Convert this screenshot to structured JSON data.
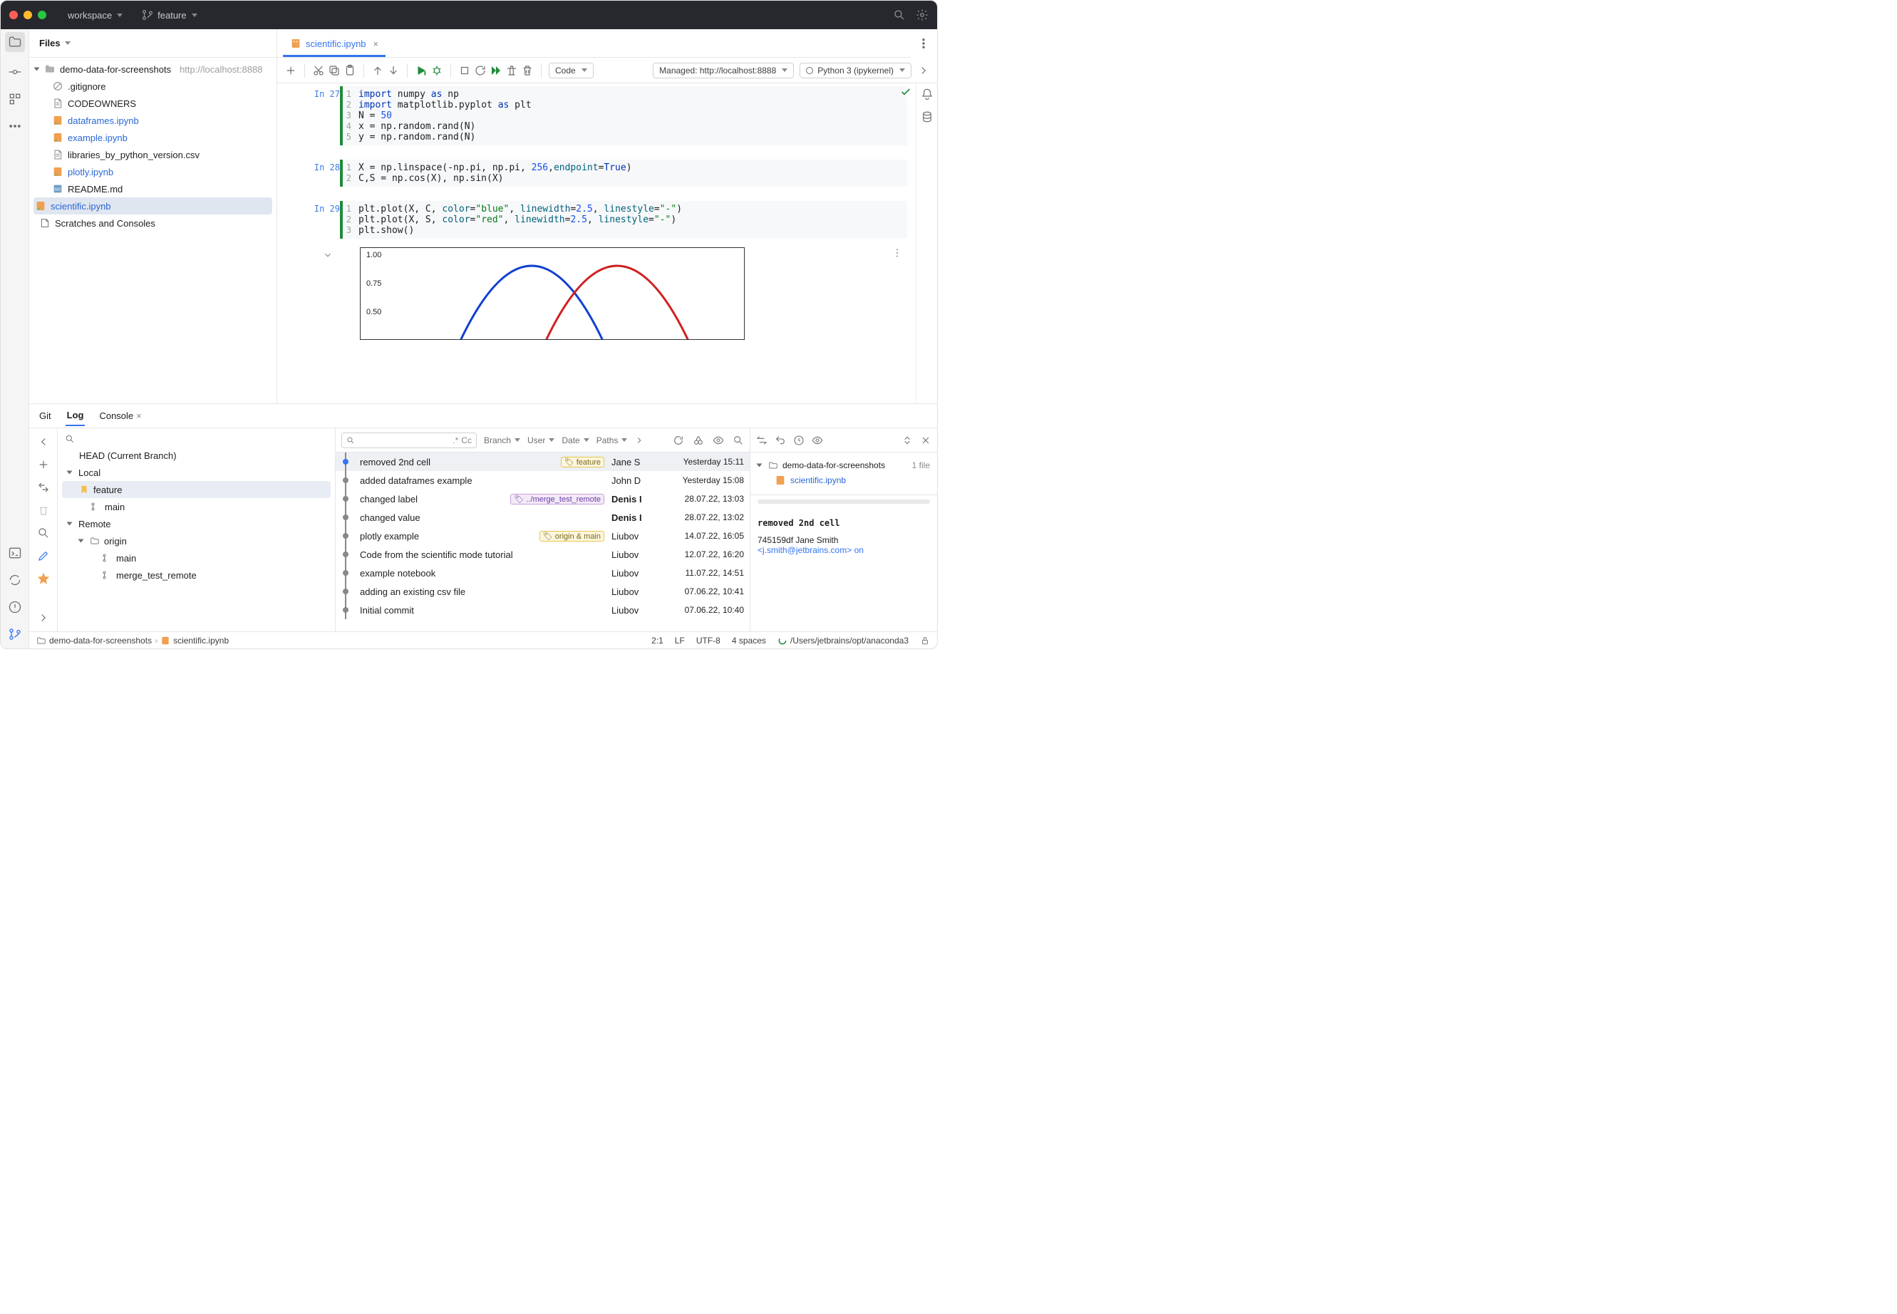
{
  "titlebar": {
    "workspace": "workspace",
    "branch": "feature"
  },
  "project": {
    "header": "Files",
    "root": "demo-data-for-screenshots",
    "root_addr": "http://localhost:8888",
    "items": [
      {
        "name": ".gitignore",
        "icon": "ignore"
      },
      {
        "name": "CODEOWNERS",
        "icon": "txt"
      },
      {
        "name": "dataframes.ipynb",
        "icon": "nb",
        "link": true
      },
      {
        "name": "example.ipynb",
        "icon": "nb",
        "link": true
      },
      {
        "name": "libraries_by_python_version.csv",
        "icon": "txt"
      },
      {
        "name": "plotly.ipynb",
        "icon": "nb",
        "link": true
      },
      {
        "name": "README.md",
        "icon": "md"
      },
      {
        "name": "scientific.ipynb",
        "icon": "nb",
        "link": true,
        "selected": true
      }
    ],
    "scratches": "Scratches and Consoles"
  },
  "tabs": {
    "active": "scientific.ipynb"
  },
  "nb_toolbar": {
    "cell_type": "Code",
    "managed": "Managed: http://localhost:8888",
    "kernel": "Python 3 (ipykernel)"
  },
  "cells": [
    {
      "prompt": "In 27",
      "lines": [
        "import numpy as np",
        "import matplotlib.pyplot as plt",
        "N = 50",
        "x = np.random.rand(N)",
        "y = np.random.rand(N)"
      ]
    },
    {
      "prompt": "In 28",
      "lines": [
        "X = np.linspace(-np.pi, np.pi, 256,endpoint=True)",
        "C,S = np.cos(X), np.sin(X)"
      ]
    },
    {
      "prompt": "In 29",
      "lines": [
        "plt.plot(X, C, color=\"blue\", linewidth=2.5, linestyle=\"-\")",
        "plt.plot(X, S, color=\"red\", linewidth=2.5, linestyle=\"-\")",
        "plt.show()"
      ]
    }
  ],
  "plot_yticks": [
    "1.00",
    "0.75",
    "0.50"
  ],
  "bottom_tabs": [
    "Git",
    "Log",
    "Console"
  ],
  "bottom_tabs_active": "Log",
  "git": {
    "head_label": "HEAD (Current Branch)",
    "local": "Local",
    "remote": "Remote",
    "origin": "origin",
    "branches_local": [
      "feature",
      "main"
    ],
    "branches_remote": [
      "main",
      "merge_test_remote"
    ],
    "filters": [
      "Branch",
      "User",
      "Date",
      "Paths"
    ],
    "search_regex": ".*",
    "search_cc": "Cc",
    "commits": [
      {
        "msg": "removed 2nd cell",
        "tag": "feature",
        "tag_color": "yellow",
        "author": "Jane S",
        "date": "Yesterday 15:11",
        "head": true,
        "sel": true
      },
      {
        "msg": "added dataframes example",
        "author": "John D",
        "date": "Yesterday 15:08"
      },
      {
        "msg": "changed label",
        "tag": "../merge_test_remote",
        "tag_color": "purple",
        "author": "Denis I",
        "date": "28.07.22, 13:03",
        "bold": true
      },
      {
        "msg": "changed value",
        "author": "Denis I",
        "date": "28.07.22, 13:02",
        "bold": true
      },
      {
        "msg": "plotly example",
        "tag": "origin & main",
        "tag_color": "yellow",
        "author": "Liubov",
        "date": "14.07.22, 16:05"
      },
      {
        "msg": "Code from the scientific mode tutorial",
        "author": "Liubov",
        "date": "12.07.22, 16:20"
      },
      {
        "msg": "example notebook",
        "author": "Liubov",
        "date": "11.07.22, 14:51"
      },
      {
        "msg": "adding an existing csv file",
        "author": "Liubov",
        "date": "07.06.22, 10:41"
      },
      {
        "msg": "Initial commit",
        "author": "Liubov",
        "date": "07.06.22, 10:40"
      }
    ],
    "detail": {
      "root": "demo-data-for-screenshots",
      "file_count": "1 file",
      "file": "scientific.ipynb",
      "commit_msg": "removed 2nd cell",
      "hash_author": "745159df Jane Smith",
      "email_line": "<j.smith@jetbrains.com> on"
    }
  },
  "statusbar": {
    "crumbs": [
      "demo-data-for-screenshots",
      "scientific.ipynb"
    ],
    "pos": "2:1",
    "lf": "LF",
    "enc": "UTF-8",
    "indent": "4 spaces",
    "interp": "/Users/jetbrains/opt/anaconda3"
  }
}
